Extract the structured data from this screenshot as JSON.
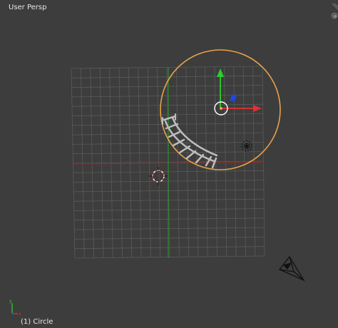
{
  "viewport": {
    "view_name": "User Persp",
    "active_object": "(1) Circle",
    "colors": {
      "background": "#3d3d3d",
      "grid": "#5a5a5a",
      "x_axis": "#8b2a2a",
      "y_axis": "#2e8b2e",
      "selection": "#e6a24a",
      "gizmo_x": "#e03030",
      "gizmo_y": "#2ad02a",
      "gizmo_z": "#2048e0"
    },
    "icons": {
      "area_split": "corner-handle-icon",
      "cursor": "3d-cursor-icon",
      "lamp": "lamp-icon",
      "camera": "camera-icon",
      "transform": "transform-manipulator-icon",
      "axes": "orientation-axes-icon"
    }
  }
}
